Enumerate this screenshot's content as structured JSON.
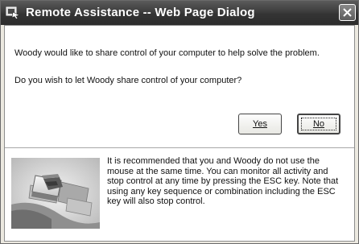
{
  "window": {
    "title": "Remote Assistance -- Web Page Dialog"
  },
  "dialog": {
    "message": "Woody would like to share control of your computer to help solve the problem.",
    "question": "Do you wish to let Woody share control of your computer?",
    "yes_label": "Yes",
    "no_label": "No",
    "info_text": "It is recommended that you and Woody  do not use the mouse at the same time. You can monitor all activity and stop control at any time by pressing the ESC key. Note that using any key sequence or combination including the ESC key will also stop control."
  },
  "icons": {
    "title": "remote-assistance-icon",
    "close": "close-icon",
    "illustration": "esc-key-illustration"
  }
}
